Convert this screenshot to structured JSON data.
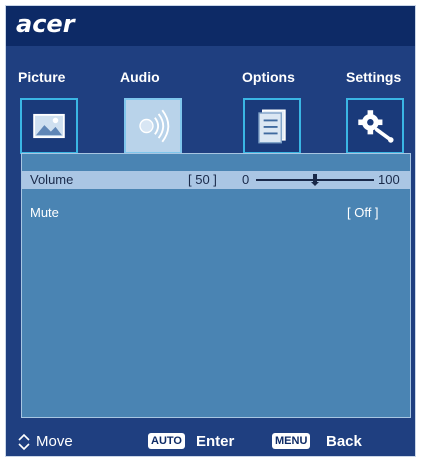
{
  "brand": {
    "logo": "acer"
  },
  "tabs": [
    {
      "label": "Picture",
      "icon": "picture-icon"
    },
    {
      "label": "Audio",
      "icon": "audio-icon"
    },
    {
      "label": "Options",
      "icon": "options-icon"
    },
    {
      "label": "Settings",
      "icon": "settings-icon"
    }
  ],
  "active_tab": "Audio",
  "menu": {
    "items": [
      {
        "label": "Volume",
        "value_text": "[ 50 ]",
        "slider": {
          "min_label": "0",
          "max_label": "100",
          "value": 50,
          "min": 0,
          "max": 100
        },
        "selected": true
      },
      {
        "label": "Mute",
        "value_text": "[ Off ]",
        "selected": false
      }
    ]
  },
  "footer": {
    "move_label": "Move",
    "enter_key": "AUTO",
    "enter_label": "Enter",
    "back_key": "MENU",
    "back_label": "Back"
  },
  "colors": {
    "background": "#1f3f80",
    "brand_bar": "#0d2a66",
    "panel": "#4a84b3",
    "selection": "#aac6e4",
    "tile_border": "#3ab6e4"
  }
}
